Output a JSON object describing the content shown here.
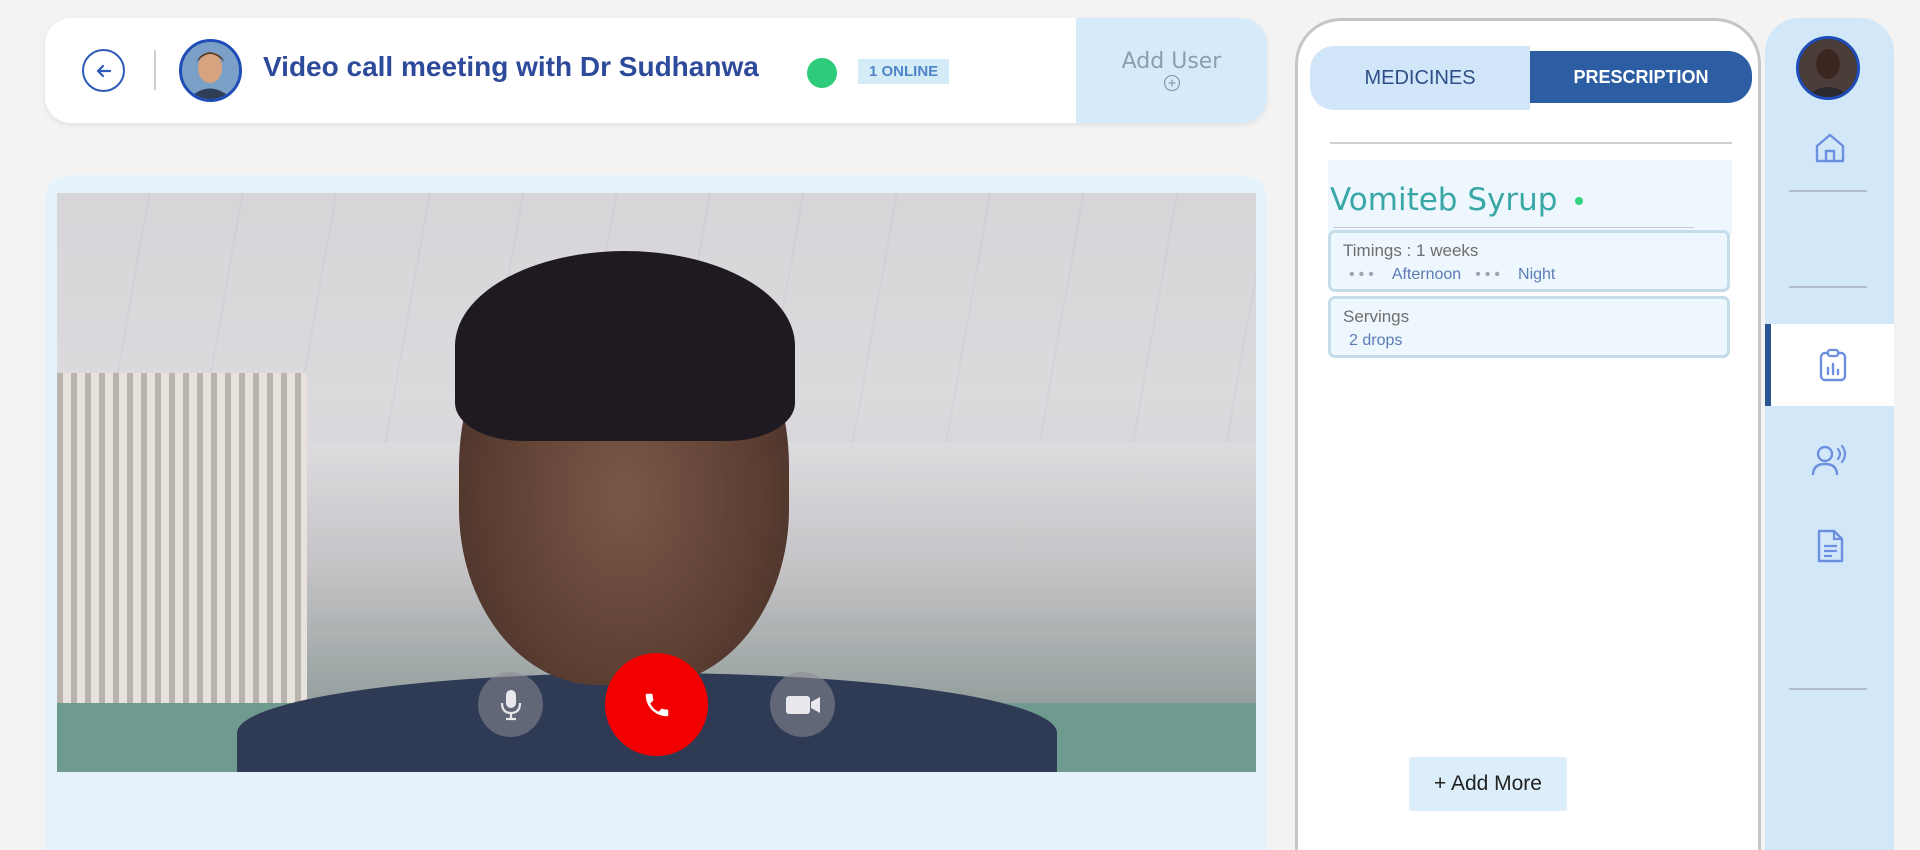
{
  "header": {
    "title": "Video call meeting with Dr Sudhanwa",
    "online_badge": "1 ONLINE",
    "add_user_label": "Add User"
  },
  "call_controls": {
    "mic": "microphone-icon",
    "end": "phone-icon",
    "camera": "video-camera-icon"
  },
  "panel": {
    "tabs": [
      {
        "label": "MEDICINES"
      },
      {
        "label": "PRESCRIPTION"
      }
    ],
    "medicine": {
      "name": "Vomiteb Syrup",
      "timings_label": "Timings : 1 weeks",
      "timing_slots": [
        "Afternoon",
        "Night"
      ],
      "servings_label": "Servings",
      "servings_value": "2 drops"
    },
    "add_more_label": "+ Add More"
  },
  "nav": {
    "items": [
      "home-icon",
      "clipboard-chart-icon",
      "voice-user-icon",
      "document-icon"
    ]
  },
  "colors": {
    "accent": "#2d5ea3",
    "online": "#2ecc7a",
    "end_call": "#f20000",
    "medicine_name": "#3aa7a7"
  }
}
